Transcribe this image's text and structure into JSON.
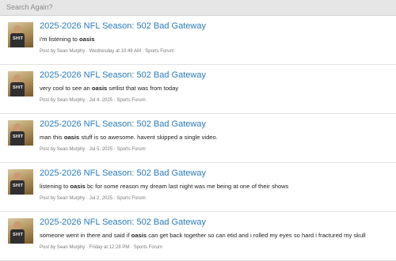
{
  "search": {
    "label": "Search Again?"
  },
  "results": [
    {
      "title": "2025-2026 NFL Season: 502 Bad Gateway",
      "snippet": {
        "before": "i'm listening to ",
        "term": "oasis",
        "after": ""
      },
      "meta": "Post by Sean Murphy · Wednesday at 10:49 AM · Sports Forum"
    },
    {
      "title": "2025-2026 NFL Season: 502 Bad Gateway",
      "snippet": {
        "before": "very cool to see an ",
        "term": "oasis",
        "after": " setlist that was from today"
      },
      "meta": "Post by Sean Murphy · Jul 4, 2025 · Sports Forum"
    },
    {
      "title": "2025-2026 NFL Season: 502 Bad Gateway",
      "snippet": {
        "before": "man this ",
        "term": "oasis",
        "after": " stuff is so awesome. havent skipped a single video."
      },
      "meta": "Post by Sean Murphy · Jul 5, 2025 · Sports Forum"
    },
    {
      "title": "2025-2026 NFL Season: 502 Bad Gateway",
      "snippet": {
        "before": "listening to ",
        "term": "oasis",
        "after": " bc for some reason my dream last night was me being at one of their shows"
      },
      "meta": "Post by Sean Murphy · Jul 2, 2025 · Sports Forum"
    },
    {
      "title": "2025-2026 NFL Season: 502 Bad Gateway",
      "snippet": {
        "before": "someone went in there and said if ",
        "term": "oasis",
        "after": " can get back together so can etid and i rolled my eyes so hard i fractured my skull"
      },
      "meta": "Post by Sean Murphy · Friday at 12:28 PM · Sports Forum"
    }
  ],
  "avatar": {
    "shirt_text": "SHIT"
  }
}
